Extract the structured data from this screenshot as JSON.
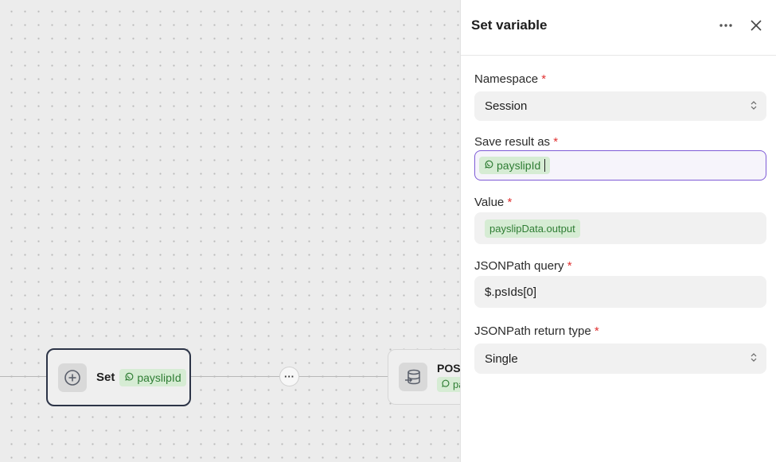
{
  "canvas": {
    "set_node": {
      "title": "Set",
      "tag": "payslipId"
    },
    "post_node": {
      "title": "POST",
      "tag": "pa"
    },
    "more_label": "···"
  },
  "panel": {
    "title": "Set variable",
    "namespace": {
      "label": "Namespace",
      "required": "*",
      "value": "Session"
    },
    "save_result": {
      "label": "Save result as",
      "required": "*",
      "tag": "payslipId"
    },
    "value": {
      "label": "Value",
      "required": "*",
      "tag": "payslipData.output"
    },
    "jsonpath_query": {
      "label": "JSONPath query",
      "required": "*",
      "value": "$.psIds[0]"
    },
    "jsonpath_return": {
      "label": "JSONPath return type",
      "required": "*",
      "value": "Single"
    }
  },
  "colors": {
    "accent": "#7e5bd6",
    "tag_bg": "#d6ecd4",
    "tag_text": "#2f7d34",
    "required": "#e03131"
  },
  "icons": [
    "plus-circle-icon",
    "database-icon",
    "whatsapp-icon",
    "more-horizontal-icon",
    "close-icon",
    "select-arrows-icon"
  ]
}
